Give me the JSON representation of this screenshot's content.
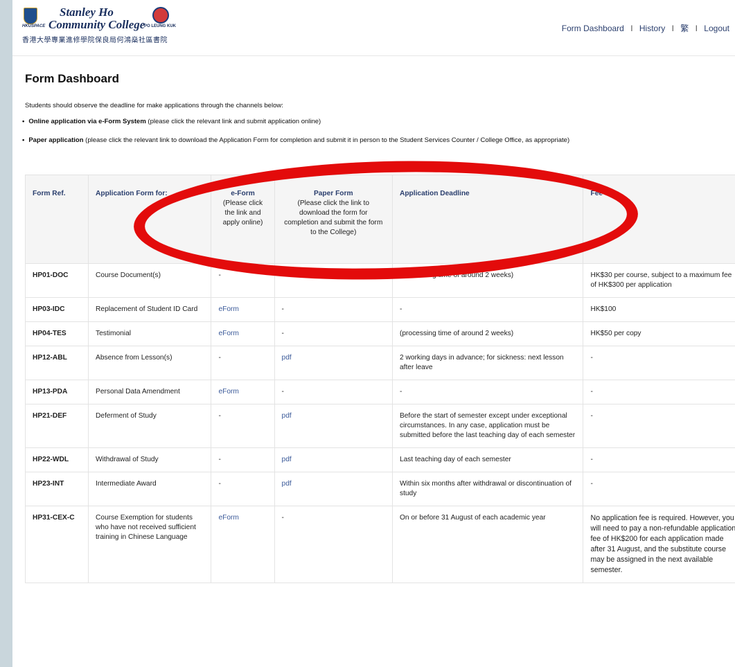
{
  "header": {
    "logo": {
      "name_line1": "Stanley Ho",
      "name_line2": "Community College",
      "left_brand": "HKUSPACE",
      "right_brand": "PO LEUNG KUK",
      "chinese_name": "香港大學專業進修學院保良局何鴻燊社區書院"
    },
    "nav": {
      "form_dashboard": "Form Dashboard",
      "history": "History",
      "language": "繁",
      "logout": "Logout",
      "separator": "I"
    }
  },
  "page": {
    "title": "Form Dashboard",
    "intro": "Students should observe the deadline for make applications through the channels below:",
    "bullets": [
      {
        "bold": "Online application via e-Form System",
        "rest": " (please click the relevant link and submit application online)"
      },
      {
        "bold": "Paper application",
        "rest": " (please click the relevant link to download the Application Form for completion and submit it in person to the Student Services Counter / College Office, as appropriate)"
      }
    ]
  },
  "table": {
    "headers": {
      "ref": "Form Ref.",
      "for": "Application Form for:",
      "eform_title": "e-Form",
      "eform_sub": "(Please click the link and apply online)",
      "paper_title": "Paper Form",
      "paper_sub": "(Please click the link to download the form for completion and submit the form to the College)",
      "deadline": "Application Deadline",
      "fee": "Fee"
    },
    "rows": [
      {
        "ref": "HP01-DOC",
        "name": "Course Document(s)",
        "eform": "-",
        "paper": "",
        "deadline": "(processing time of around 2 weeks)",
        "fee": "HK$30 per course, subject to a maximum fee of HK$300 per application"
      },
      {
        "ref": "HP03-IDC",
        "name": "Replacement of Student ID Card",
        "eform": "eForm",
        "paper": "-",
        "deadline": "-",
        "fee": "HK$100"
      },
      {
        "ref": "HP04-TES",
        "name": "Testimonial",
        "eform": "eForm",
        "paper": "-",
        "deadline": "(processing time of around 2 weeks)",
        "fee": "HK$50 per copy"
      },
      {
        "ref": "HP12-ABL",
        "name": "Absence from Lesson(s)",
        "eform": "-",
        "paper": "pdf",
        "deadline": "2 working days in advance; for sickness: next lesson after leave",
        "fee": "-"
      },
      {
        "ref": "HP13-PDA",
        "name": "Personal Data Amendment",
        "eform": "eForm",
        "paper": "-",
        "deadline": "-",
        "fee": "-"
      },
      {
        "ref": "HP21-DEF",
        "name": "Deferment of Study",
        "eform": "-",
        "paper": "pdf",
        "deadline": "Before the start of semester except under exceptional circumstances. In any case, application must be submitted before the last teaching day of each semester",
        "fee": "-"
      },
      {
        "ref": "HP22-WDL",
        "name": "Withdrawal of Study",
        "eform": "-",
        "paper": "pdf",
        "deadline": "Last teaching day of each semester",
        "fee": "-"
      },
      {
        "ref": "HP23-INT",
        "name": "Intermediate Award",
        "eform": "-",
        "paper": "pdf",
        "deadline": "Within six months after withdrawal or discontinuation of study",
        "fee": "-"
      },
      {
        "ref": "HP31-CEX-C",
        "name": "Course Exemption for students who have not received sufficient training in Chinese Language",
        "eform": "eForm",
        "paper": "-",
        "deadline": "On or before 31 August of each academic year",
        "fee": "No application fee is required. However, you will need to pay a non-refundable application fee of HK$200 for each application made after 31 August, and the substitute course may be assigned in the next available semester."
      }
    ]
  },
  "colors": {
    "annotation": "#e30b0b",
    "link": "#3b5a99",
    "nav": "#2b3f6e"
  }
}
